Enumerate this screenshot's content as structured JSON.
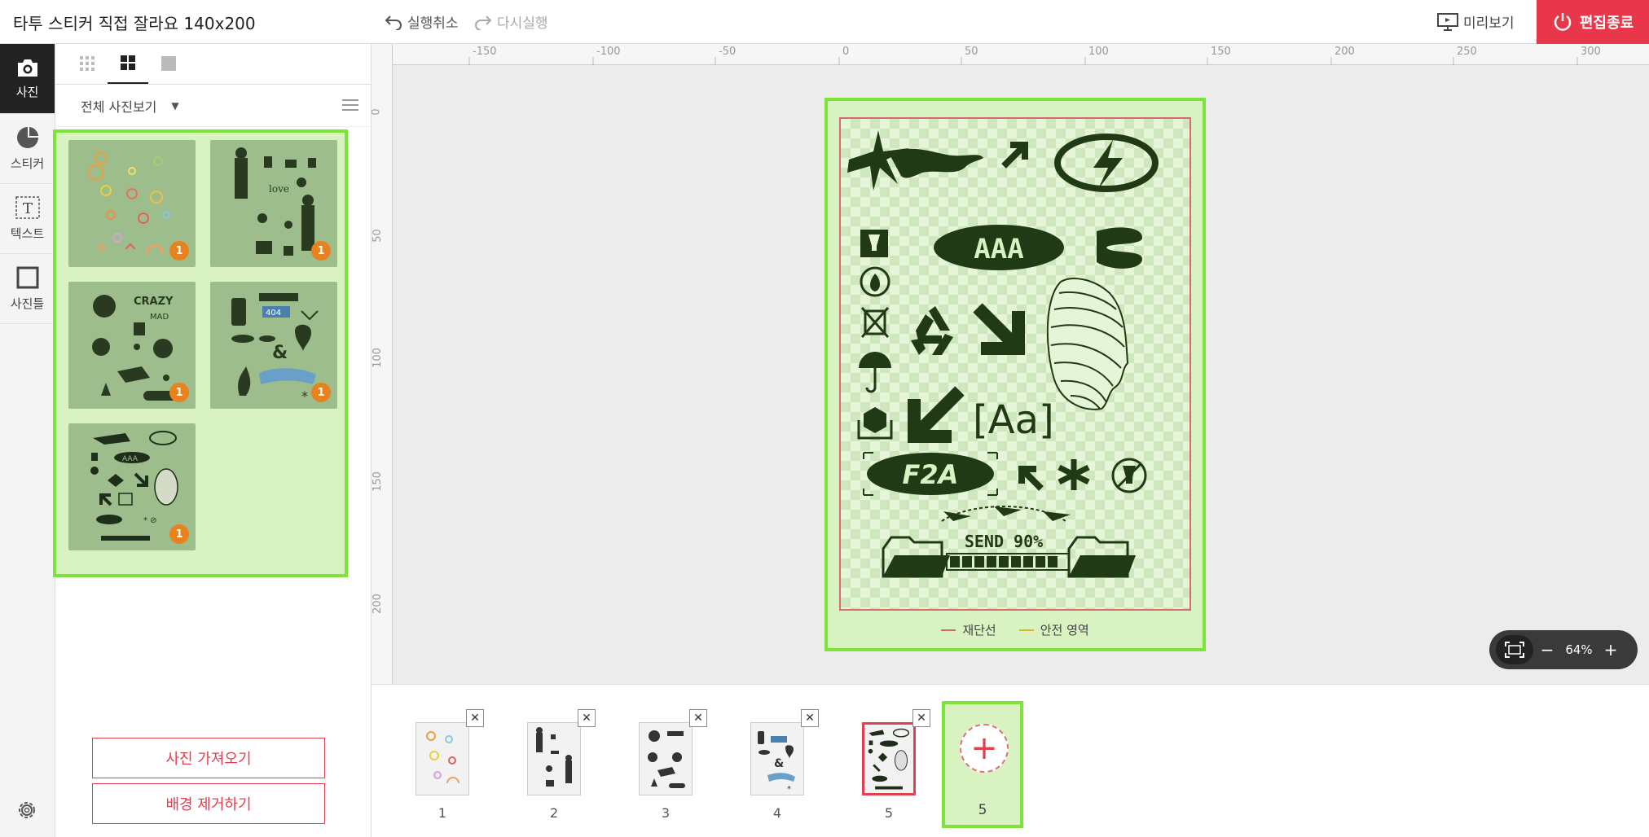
{
  "header": {
    "title": "타투 스티커 직접 잘라요 140x200",
    "undo_label": "실행취소",
    "redo_label": "다시실행",
    "preview_label": "미리보기",
    "finish_label": "편집종료"
  },
  "rail": {
    "items": [
      {
        "label": "사진",
        "icon": "camera-icon"
      },
      {
        "label": "스티커",
        "icon": "sticker-icon"
      },
      {
        "label": "텍스트",
        "icon": "text-icon"
      },
      {
        "label": "사진틀",
        "icon": "frame-icon"
      }
    ]
  },
  "panel": {
    "filter_label": "전체 사진보기",
    "thumb_badges": [
      "1",
      "1",
      "1",
      "1",
      "1"
    ],
    "import_label": "사진 가져오기",
    "remove_bg_label": "배경 제거하기"
  },
  "canvas": {
    "ruler_top": [
      "-150",
      "-100",
      "-50",
      "0",
      "50",
      "100",
      "150",
      "200",
      "250",
      "300"
    ],
    "ruler_left": [
      "0",
      "50",
      "100",
      "150",
      "200"
    ],
    "sticker_texts": {
      "aaa": "AAA",
      "aa": "[Aa]",
      "f2a": "F2A",
      "send": "SEND 90%"
    },
    "legend_cut": "재단선",
    "legend_safe": "안전 영역",
    "colors": {
      "cut": "#d56b6b",
      "safe": "#d9b82a",
      "accent": "#e8364a",
      "highlight": "#7de43a"
    }
  },
  "zoom": {
    "value": "64%",
    "minus": "−",
    "plus": "+"
  },
  "pages": {
    "numbers": [
      "1",
      "2",
      "3",
      "4",
      "5"
    ],
    "close": "✕",
    "add_label": "5"
  }
}
